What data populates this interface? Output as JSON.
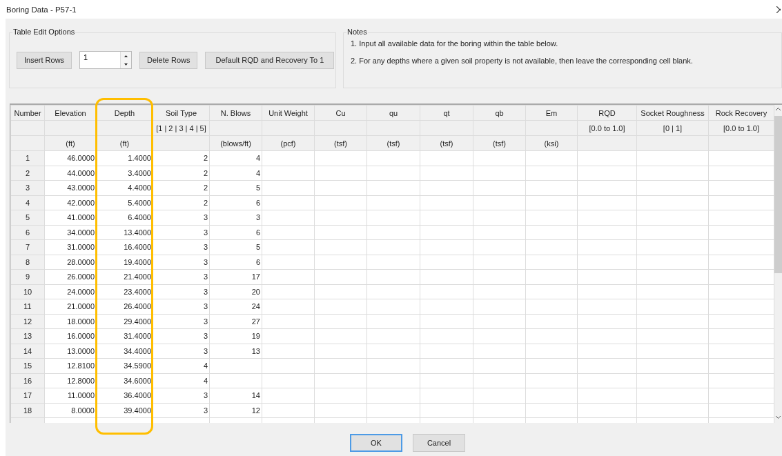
{
  "window": {
    "title": "Boring Data - P57-1"
  },
  "table_edit_options": {
    "title": "Table Edit Options",
    "insert_button": "Insert Rows",
    "row_count": "1",
    "delete_button": "Delete Rows",
    "default_button": "Default RQD and Recovery To 1"
  },
  "notes": {
    "title": "Notes",
    "items": [
      "1. Input all available data for the boring within the table below.",
      "2. For any depths where a given soil property is not available, then leave the corresponding cell blank."
    ]
  },
  "table": {
    "columns": [
      {
        "header": "Number"
      },
      {
        "header": "Elevation",
        "unit": "(ft)"
      },
      {
        "header": "Depth",
        "unit": "(ft)"
      },
      {
        "header": "Soil Type",
        "range": "[1 | 2 | 3 | 4 | 5]"
      },
      {
        "header": "N. Blows",
        "unit": "(blows/ft)"
      },
      {
        "header": "Unit Weight",
        "unit": "(pcf)"
      },
      {
        "header": "Cu",
        "unit": "(tsf)"
      },
      {
        "header": "qu",
        "unit": "(tsf)"
      },
      {
        "header": "qt",
        "unit": "(tsf)"
      },
      {
        "header": "qb",
        "unit": "(tsf)"
      },
      {
        "header": "Em",
        "unit": "(ksi)"
      },
      {
        "header": "RQD",
        "range": "[0.0 to 1.0]"
      },
      {
        "header": "Socket Roughness",
        "range": "[0 | 1]"
      },
      {
        "header": "Rock Recovery",
        "range": "[0.0 to 1.0]"
      }
    ],
    "rows": [
      {
        "number": "1",
        "elevation": "46.0000",
        "depth": "1.4000",
        "soil_type": "2",
        "n_blows": "4"
      },
      {
        "number": "2",
        "elevation": "44.0000",
        "depth": "3.4000",
        "soil_type": "2",
        "n_blows": "4"
      },
      {
        "number": "3",
        "elevation": "43.0000",
        "depth": "4.4000",
        "soil_type": "2",
        "n_blows": "5"
      },
      {
        "number": "4",
        "elevation": "42.0000",
        "depth": "5.4000",
        "soil_type": "2",
        "n_blows": "6"
      },
      {
        "number": "5",
        "elevation": "41.0000",
        "depth": "6.4000",
        "soil_type": "3",
        "n_blows": "3"
      },
      {
        "number": "6",
        "elevation": "34.0000",
        "depth": "13.4000",
        "soil_type": "3",
        "n_blows": "6"
      },
      {
        "number": "7",
        "elevation": "31.0000",
        "depth": "16.4000",
        "soil_type": "3",
        "n_blows": "5"
      },
      {
        "number": "8",
        "elevation": "28.0000",
        "depth": "19.4000",
        "soil_type": "3",
        "n_blows": "6"
      },
      {
        "number": "9",
        "elevation": "26.0000",
        "depth": "21.4000",
        "soil_type": "3",
        "n_blows": "17"
      },
      {
        "number": "10",
        "elevation": "24.0000",
        "depth": "23.4000",
        "soil_type": "3",
        "n_blows": "20"
      },
      {
        "number": "11",
        "elevation": "21.0000",
        "depth": "26.4000",
        "soil_type": "3",
        "n_blows": "24"
      },
      {
        "number": "12",
        "elevation": "18.0000",
        "depth": "29.4000",
        "soil_type": "3",
        "n_blows": "27"
      },
      {
        "number": "13",
        "elevation": "16.0000",
        "depth": "31.4000",
        "soil_type": "3",
        "n_blows": "19"
      },
      {
        "number": "14",
        "elevation": "13.0000",
        "depth": "34.4000",
        "soil_type": "3",
        "n_blows": "13"
      },
      {
        "number": "15",
        "elevation": "12.8100",
        "depth": "34.5900",
        "soil_type": "4"
      },
      {
        "number": "16",
        "elevation": "12.8000",
        "depth": "34.6000",
        "soil_type": "4"
      },
      {
        "number": "17",
        "elevation": "11.0000",
        "depth": "36.4000",
        "soil_type": "3",
        "n_blows": "14"
      },
      {
        "number": "18",
        "elevation": "8.0000",
        "depth": "39.4000",
        "soil_type": "3",
        "n_blows": "12"
      }
    ]
  },
  "buttons": [
    {
      "label": "OK",
      "default": true
    },
    {
      "label": "Cancel",
      "default": false
    }
  ]
}
